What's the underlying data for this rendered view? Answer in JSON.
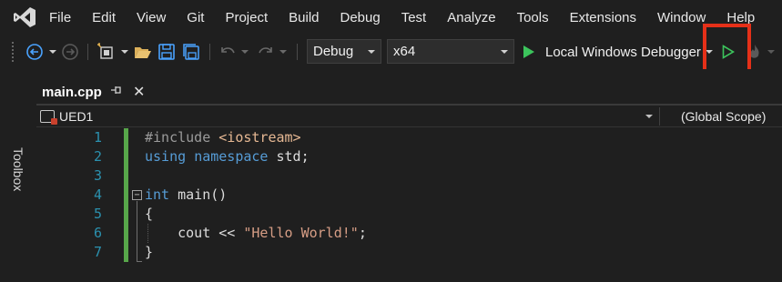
{
  "menu": [
    "File",
    "Edit",
    "View",
    "Git",
    "Project",
    "Build",
    "Debug",
    "Test",
    "Analyze",
    "Tools",
    "Extensions",
    "Window",
    "Help"
  ],
  "toolbar": {
    "config": "Debug",
    "platform": "x64",
    "debugger": "Local Windows Debugger"
  },
  "sidebar": {
    "toolbox": "Toolbox"
  },
  "tab": {
    "filename": "main.cpp",
    "pin": "⊣",
    "close": "✕"
  },
  "navbar": {
    "project": "UED1",
    "scope": "(Global Scope)"
  },
  "editor": {
    "line_numbers": [
      "1",
      "2",
      "3",
      "4",
      "5",
      "6",
      "7"
    ],
    "lines": {
      "l1_directive": "#include ",
      "l1_header": "<iostream>",
      "l2_using": "using",
      "l2_namespace": "namespace",
      "l2_rest": " std;",
      "l4_int": "int",
      "l4_rest": " main()",
      "l5": "{",
      "l6_code": "    cout << ",
      "l6_string": "\"Hello World!\"",
      "l6_end": ";",
      "l7": "}"
    }
  },
  "colors": {
    "keyword": "#569cd6",
    "string": "#d69d85",
    "line_number": "#2b91af",
    "change_bar": "#57a64a",
    "run_green": "#3cc45c",
    "highlight": "#e53018"
  }
}
